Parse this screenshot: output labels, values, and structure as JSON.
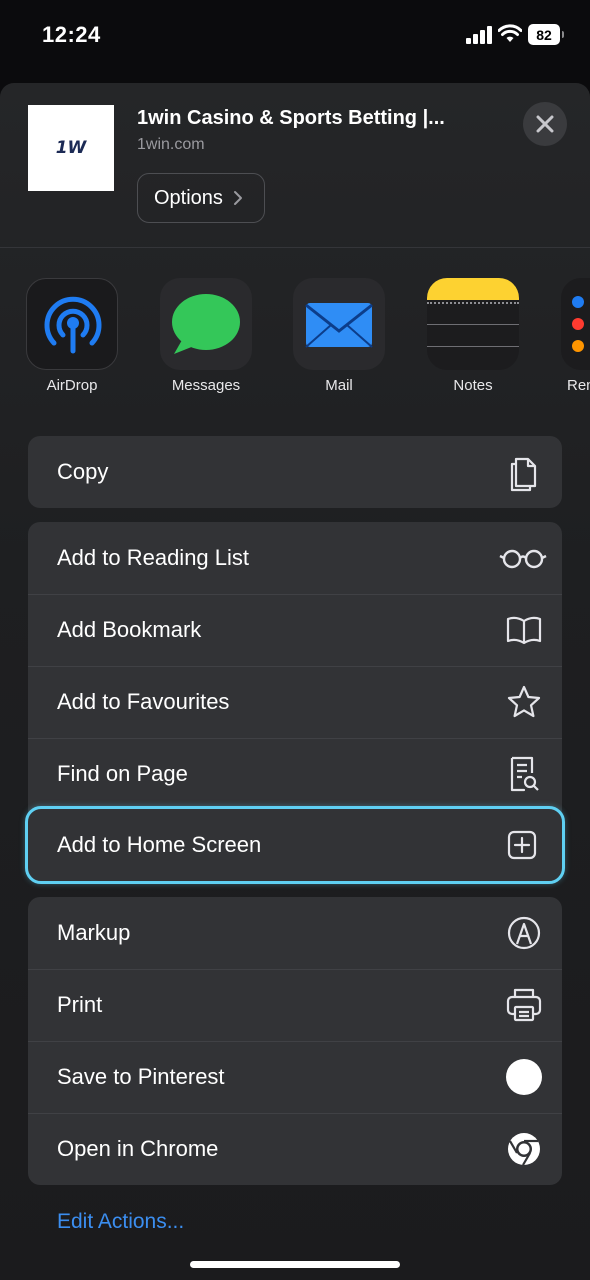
{
  "status_bar": {
    "time": "12:24",
    "battery": "82"
  },
  "header": {
    "thumb_text": "1W",
    "title": "1win Casino & Sports Betting |...",
    "url": "1win.com",
    "options_label": "Options"
  },
  "apps": [
    {
      "label": "AirDrop",
      "icon": "airdrop-icon"
    },
    {
      "label": "Messages",
      "icon": "messages-icon"
    },
    {
      "label": "Mail",
      "icon": "mail-icon"
    },
    {
      "label": "Notes",
      "icon": "notes-icon"
    },
    {
      "label": "Rem",
      "icon": "reminders-icon"
    }
  ],
  "actions": {
    "copy": "Copy",
    "reading_list": "Add to Reading List",
    "bookmark": "Add Bookmark",
    "favourites": "Add to Favourites",
    "find_on_page": "Find on Page",
    "home_screen": "Add to Home Screen",
    "markup": "Markup",
    "print": "Print",
    "pinterest": "Save to Pinterest",
    "open_chrome": "Open in Chrome"
  },
  "edit_actions": "Edit Actions...",
  "colors": {
    "accent": "#3b8ef0",
    "highlight": "#5fd0f3",
    "row_bg": "#323336"
  }
}
